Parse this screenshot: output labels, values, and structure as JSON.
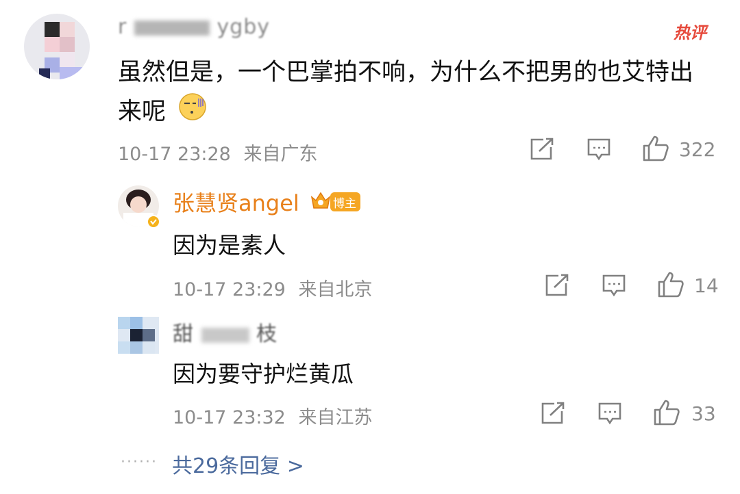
{
  "hot_tag": "热评",
  "main_comment": {
    "username": "r",
    "username_tail": "ygby",
    "text": "虽然但是，一个巴掌拍不响，为什么不把男的也艾特出来呢",
    "time": "10-17 23:28",
    "location": "来自广东",
    "likes": "322"
  },
  "replies": [
    {
      "username": "张慧贤angel",
      "badge": "博主",
      "text": "因为是素人",
      "time": "10-17 23:29",
      "location": "来自北京",
      "likes": "14"
    },
    {
      "username": "甜",
      "username_tail": "枝",
      "text": "因为要守护烂黄瓜",
      "time": "10-17 23:32",
      "location": "来自江苏",
      "likes": "33"
    }
  ],
  "more_replies": "共29条回复 >",
  "colors": {
    "accent": "#e8801a",
    "link": "#4b6a9d",
    "hot": "#e6493b"
  },
  "icons": [
    "share-icon",
    "comment-icon",
    "like-icon",
    "speechless-emoji-icon",
    "verified-icon",
    "crown-icon"
  ]
}
